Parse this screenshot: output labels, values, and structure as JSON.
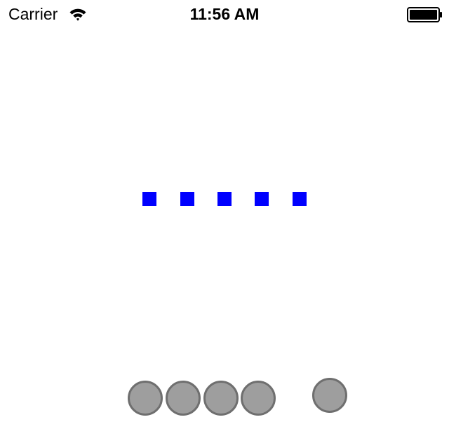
{
  "status_bar": {
    "carrier": "Carrier",
    "time": "11:56 AM",
    "wifi_icon": "wifi-icon",
    "battery_icon": "battery-full-icon",
    "battery_level": 1.0
  },
  "colors": {
    "square": "#0000ff",
    "circle_fill": "#9e9e9e",
    "circle_border": "#6f6f6f",
    "background": "#ffffff"
  },
  "squares_count": 5,
  "circles_count": 5
}
